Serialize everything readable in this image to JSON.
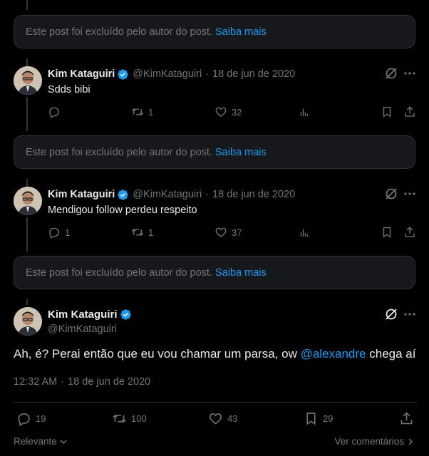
{
  "deleted": {
    "text": "Este post foi excluído pelo autor do post.",
    "link": "Saiba mais"
  },
  "replies": [
    {
      "name": "Kim Kataguiri",
      "handle": "@KimKataguiri",
      "date": "18 de jun de 2020",
      "text": "Sdds bibi",
      "replies_count": "",
      "retweets": "1",
      "likes": "32"
    },
    {
      "name": "Kim Kataguiri",
      "handle": "@KimKataguiri",
      "date": "18 de jun de 2020",
      "text": "Mendigou follow perdeu respeito",
      "replies_count": "1",
      "retweets": "1",
      "likes": "37"
    }
  ],
  "main": {
    "name": "Kim Kataguiri",
    "handle": "@KimKataguiri",
    "text_before": "Ah, é? Perai então que eu vou chamar um parsa, ow ",
    "mention": "@alexandre",
    "text_after": " chega aí",
    "time": "12:32 AM",
    "date": "18 de jun de 2020",
    "replies": "19",
    "retweets": "100",
    "likes": "43",
    "bookmarks": "29"
  },
  "footer": {
    "sort_label": "Relevante",
    "view_comments": "Ver comentários"
  },
  "colors": {
    "accent": "#1d9bf0",
    "muted": "#71767b",
    "background": "#000000"
  },
  "sep": "·"
}
